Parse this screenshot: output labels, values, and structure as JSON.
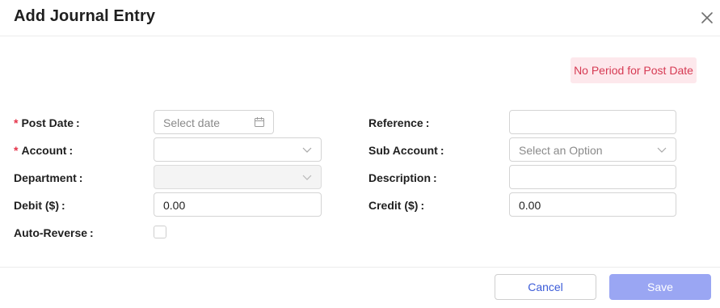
{
  "dialog": {
    "title": "Add Journal Entry",
    "close_icon": "close-icon"
  },
  "alert": {
    "text": "No Period for Post Date",
    "color": "#d63a53",
    "background": "#fde8ec"
  },
  "form": {
    "required_marker": "*",
    "post_date": {
      "label": "Post Date",
      "placeholder": "Select date",
      "icon": "calendar-icon"
    },
    "account": {
      "label": "Account",
      "value": "",
      "icon": "chevron-down-icon"
    },
    "department": {
      "label": "Department",
      "value": "",
      "disabled": true,
      "icon": "chevron-down-icon"
    },
    "debit": {
      "label": "Debit ($)",
      "value": "0.00"
    },
    "auto_reverse": {
      "label": "Auto-Reverse",
      "checked": false
    },
    "reference": {
      "label": "Reference",
      "value": ""
    },
    "sub_account": {
      "label": "Sub Account",
      "placeholder": "Select an Option",
      "icon": "chevron-down-icon"
    },
    "description": {
      "label": "Description",
      "value": ""
    },
    "credit": {
      "label": "Credit ($)",
      "value": "0.00"
    }
  },
  "footer": {
    "cancel_label": "Cancel",
    "save_label": "Save",
    "accent_color": "#3b5bd8",
    "save_color": "#9aa6f3"
  }
}
